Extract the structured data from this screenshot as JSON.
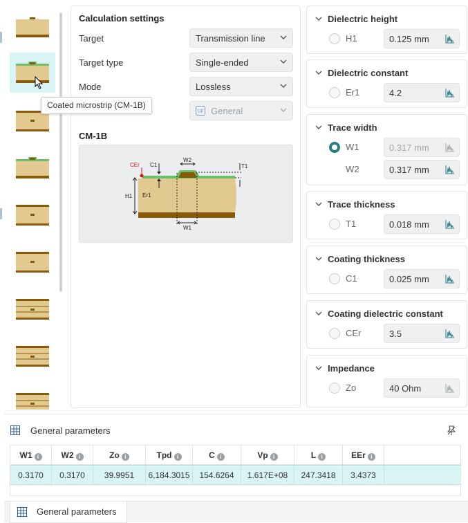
{
  "calc": {
    "title": "Calculation settings",
    "rows": [
      {
        "label": "Target",
        "value": "Transmission line"
      },
      {
        "label": "Target type",
        "value": "Single-ended"
      },
      {
        "label": "Mode",
        "value": "Lossless"
      },
      {
        "label": "",
        "value": "General",
        "disabled": true
      }
    ],
    "structure_name": "CM-1B",
    "diagram_labels": {
      "cer": "CEr",
      "c1": "C1",
      "w2": "W2",
      "t1": "T1",
      "h1": "H1",
      "er1": "Er1",
      "w1": "W1"
    }
  },
  "tooltip": "Coated microstrip (CM-1B)",
  "cards": [
    {
      "title": "Dielectric height",
      "params": [
        {
          "name": "H1",
          "value": "0.125 mm",
          "radio": false,
          "dim": false
        }
      ]
    },
    {
      "title": "Dielectric constant",
      "params": [
        {
          "name": "Er1",
          "value": "4.2",
          "radio": false,
          "dim": false
        }
      ]
    },
    {
      "title": "Trace width",
      "params": [
        {
          "name": "W1",
          "value": "0.317 mm",
          "radio": true,
          "dim": true
        },
        {
          "name": "W2",
          "value": "0.317 mm",
          "dim": false,
          "noradio": true
        }
      ]
    },
    {
      "title": "Trace thickness",
      "params": [
        {
          "name": "T1",
          "value": "0.018 mm",
          "radio": false,
          "dim": false
        }
      ]
    },
    {
      "title": "Coating thickness",
      "params": [
        {
          "name": "C1",
          "value": "0.025 mm",
          "radio": false,
          "dim": false
        }
      ]
    },
    {
      "title": "Coating dielectric constant",
      "params": [
        {
          "name": "CEr",
          "value": "3.5",
          "radio": false,
          "dim": false
        }
      ]
    },
    {
      "title": "Impedance",
      "params": [
        {
          "name": "Zo",
          "value": "40 Ohm",
          "radio": false,
          "dim": false
        }
      ]
    }
  ],
  "general": {
    "title": "General parameters",
    "columns": [
      "W1",
      "W2",
      "Zo",
      "Tpd",
      "C",
      "Vp",
      "L",
      "EEr"
    ],
    "values": [
      "0.3170",
      "0.3170",
      "39.9951",
      "6,184.3015",
      "154.6264",
      "1.617E+08",
      "247.3418",
      "3.4373"
    ],
    "tab_label": "General parameters"
  },
  "colors": {
    "accent": "#2b7a86",
    "selected": "#d9f4f5",
    "copper": "#8a5a0b",
    "substrate": "#e2c98f",
    "coating": "#6cbf6a"
  }
}
